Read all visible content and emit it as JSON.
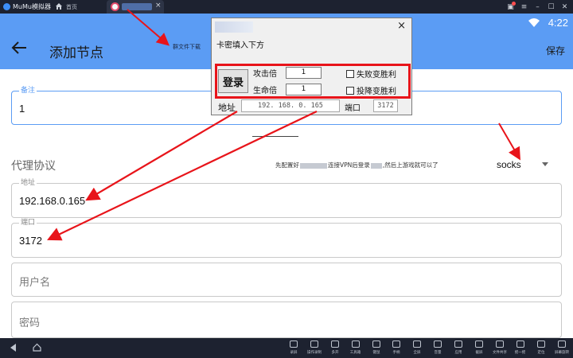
{
  "emulator": {
    "app_name": "MuMu模拟器",
    "home_tab_label": "首页",
    "tab_close": "×",
    "window_icons": [
      "gift-icon",
      "menu-icon",
      "minimize-icon",
      "maximize-icon",
      "close-icon"
    ],
    "window_icon_glyphs": [
      "▣",
      "≡",
      "–",
      "☐",
      "✕"
    ]
  },
  "android": {
    "clock": "4:22",
    "page_title": "添加节点",
    "save_label": "保存"
  },
  "annotation": {
    "group_file_label": "群文件下载"
  },
  "form": {
    "remark": {
      "label": "备注",
      "value": "1"
    },
    "proxy_protocol_label": "代理协议",
    "hint": {
      "part1": "先配置好",
      "part2": "连接VPN后登录",
      "part3": ",然后上游戏就可以了"
    },
    "protocol_value": "socks",
    "address": {
      "label": "地址",
      "value": "192.168.0.165"
    },
    "port": {
      "label": "端口",
      "value": "3172"
    },
    "username": {
      "placeholder": "用户名"
    },
    "password": {
      "placeholder": "密码"
    }
  },
  "popup": {
    "close": "×",
    "heading": "卡密填入下方",
    "login_label": "登录",
    "attack_label": "攻击倍",
    "attack_value": "1",
    "health_label": "生命倍",
    "health_value": "1",
    "fail_win_label": "失败变胜利",
    "surrender_win_label": "投降变胜利",
    "address_label": "地址",
    "address_value": "192. 168. 0. 165",
    "port_label": "端口",
    "port_value": "3172"
  },
  "bottom_toolbar": [
    {
      "label": "录屏",
      "icon": "record-icon"
    },
    {
      "label": "操作录制",
      "icon": "macro-icon"
    },
    {
      "label": "多开",
      "icon": "multi-instance-icon"
    },
    {
      "label": "工具箱",
      "icon": "toolbox-icon"
    },
    {
      "label": "键鼠",
      "icon": "keyboard-icon"
    },
    {
      "label": "手柄",
      "icon": "gamepad-icon"
    },
    {
      "label": "全屏",
      "icon": "fullscreen-icon"
    },
    {
      "label": "音量",
      "icon": "volume-icon"
    },
    {
      "label": "应用",
      "icon": "apk-icon"
    },
    {
      "label": "截屏",
      "icon": "screenshot-icon"
    },
    {
      "label": "文件共享",
      "icon": "folder-icon"
    },
    {
      "label": "摇一摇",
      "icon": "shake-icon"
    },
    {
      "label": "定位",
      "icon": "location-icon"
    },
    {
      "label": "屏幕旋转",
      "icon": "rotate-icon"
    }
  ],
  "colors": {
    "appbar": "#5b9cf4",
    "accent": "#5b9cf4",
    "annotation_red": "#e8141a",
    "emulator_chrome": "#1d2230"
  }
}
